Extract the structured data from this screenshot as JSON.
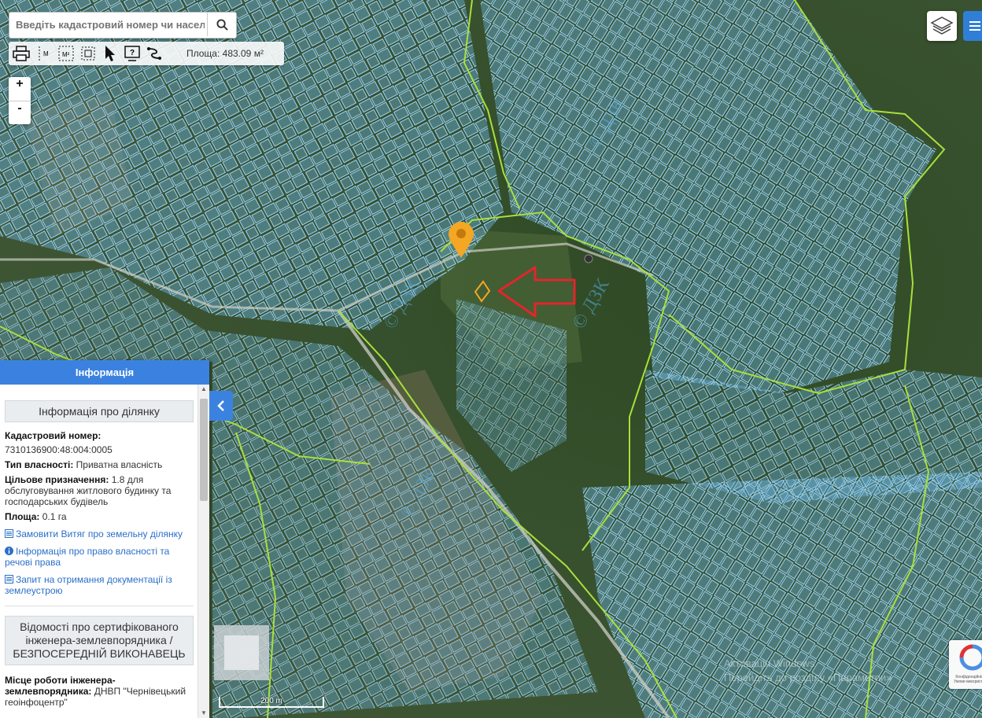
{
  "search": {
    "placeholder": "Введіть кадастровий номер чи населе"
  },
  "toolbar": {
    "area_output": "Площа: 483.09 м²"
  },
  "zoom": {
    "in_label": "+",
    "out_label": "-"
  },
  "map": {
    "watermark": "© ДЗК",
    "scale_label": "200 m"
  },
  "panel": {
    "header": "Інформація",
    "parcel_title": "Інформація про ділянку",
    "cadastral_label": "Кадастровий номер:",
    "cadastral_value": "7310136900:48:004:0005",
    "ownership_label": "Тип власності:",
    "ownership_value": "Приватна власність",
    "purpose_label": "Цільове призначення:",
    "purpose_value": "1.8 для обслуговування житлового будинку та господарських будівель",
    "area_label": "Площа:",
    "area_value": "0.1 га",
    "links": [
      "Замовити Витяг про земельну ділянку",
      "Інформація про право власності та речові права",
      "Запит на отримання документації із землеустрою"
    ],
    "engineer_title": "Відомості про сертифікованого інженера-землевпорядника / БЕЗПОСЕРЕДНІЙ ВИКОНАВЕЦЬ",
    "engineer_workplace_label": "Місце роботи інженера-землевпорядника:",
    "engineer_workplace_value": "ДНВП \"Чернівецький геоінфоцентр\""
  },
  "recaptcha": {
    "text": "Конфіденційність - Умови використання"
  },
  "watermark_text": {
    "line1": "Активація Windows",
    "line2": "Перейдіть до розділу «Параметри»"
  },
  "colors": {
    "parcel_fill": "#5ab4f0",
    "boundary_line": "#a8e03c",
    "highlight": "#f5a623",
    "arrow": "#e3252b",
    "panel_header": "#3b82e0"
  },
  "icons": [
    "search-icon",
    "print-icon",
    "measure-line-icon",
    "measure-area-icon",
    "select-area-icon",
    "select-rect-icon",
    "pointer-icon",
    "help-icon",
    "route-icon",
    "layers-icon",
    "menu-icon",
    "chevron-left-icon",
    "pin-icon",
    "info-icon",
    "document-icon"
  ]
}
